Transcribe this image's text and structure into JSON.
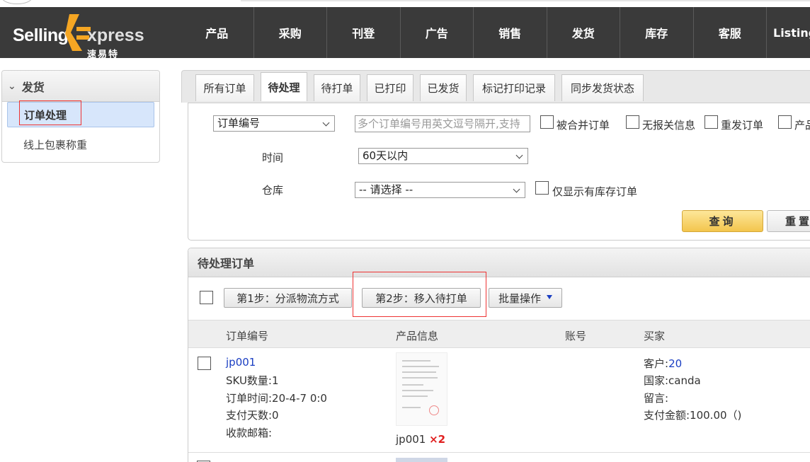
{
  "header": {
    "logo_selling": "Selling",
    "logo_xpress": "xpress",
    "logo_sub": "速易特",
    "nav": [
      "产品",
      "采购",
      "刊登",
      "广告",
      "销售",
      "发货",
      "库存",
      "客服",
      "Listing"
    ]
  },
  "sidebar": {
    "title": "发货",
    "items": [
      "订单处理",
      "线上包裹称重"
    ]
  },
  "tabs": [
    "所有订单",
    "待处理",
    "待打单",
    "已打印",
    "已发货",
    "标记打印记录",
    "同步发货状态"
  ],
  "filter": {
    "order_field_select": "订单编号",
    "order_input_placeholder": "多个订单编号用英文逗号隔开,支持",
    "checkboxes": [
      "被合并订单",
      "无报关信息",
      "重发订单",
      "产品"
    ],
    "time_label": "时间",
    "time_select": "60天以内",
    "warehouse_label": "仓库",
    "warehouse_select": "-- 请选择 --",
    "stock_only_label": "仅显示有库存订单",
    "query_button": "查询",
    "reset_button": "重置"
  },
  "orders": {
    "title": "待处理订单",
    "step1_button": "第1步：分派物流方式",
    "step2_button": "第2步：移入待打单",
    "batch_button": "批量操作",
    "columns": [
      "订单编号",
      "产品信息",
      "账号",
      "买家"
    ],
    "rows": [
      {
        "order_id": "jp001",
        "sku_count": "SKU数量:1",
        "order_time": "订单时间:20-4-7 0:0",
        "pay_days": "支付天数:0",
        "email": "收款邮箱:",
        "product_sku": "jp001",
        "product_qty": "×2",
        "customer_label": "客户:",
        "customer_value": "20",
        "country": "国家:canda",
        "message": "留言:",
        "amount": "支付金额:100.00（)"
      }
    ]
  }
}
